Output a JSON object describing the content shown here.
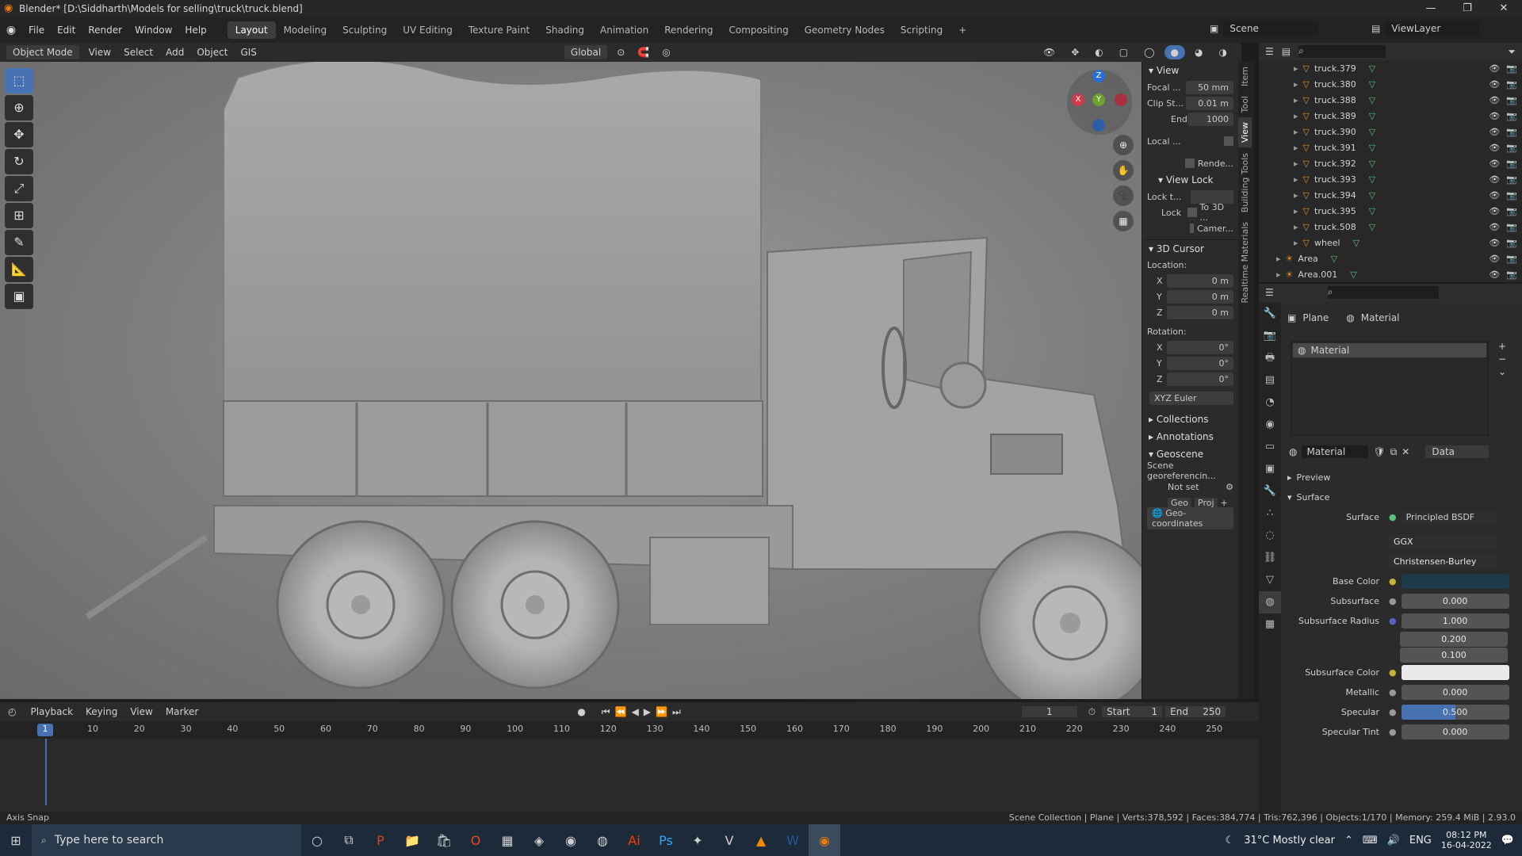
{
  "window": {
    "title": "Blender* [D:\\Siddharth\\Models for selling\\truck\\truck.blend]"
  },
  "menu": [
    "File",
    "Edit",
    "Render",
    "Window",
    "Help"
  ],
  "workspaces": [
    {
      "label": "Layout",
      "active": true
    },
    {
      "label": "Modeling"
    },
    {
      "label": "Sculpting"
    },
    {
      "label": "UV Editing"
    },
    {
      "label": "Texture Paint"
    },
    {
      "label": "Shading"
    },
    {
      "label": "Animation"
    },
    {
      "label": "Rendering"
    },
    {
      "label": "Compositing"
    },
    {
      "label": "Geometry Nodes"
    },
    {
      "label": "Scripting"
    }
  ],
  "scene": {
    "label": "Scene"
  },
  "viewlayer": {
    "label": "ViewLayer"
  },
  "viewport_header": {
    "mode": "Object Mode",
    "items": [
      "View",
      "Select",
      "Add",
      "Object",
      "GIS"
    ],
    "orientation": "Global"
  },
  "npanel": {
    "view_title": "View",
    "focal_label": "Focal ...",
    "focal_value": "50 mm",
    "clipstart_label": "Clip St...",
    "clipstart_value": "0.01 m",
    "end_label": "End",
    "end_value": "1000",
    "local_label": "Local ...",
    "rende_label": "Rende...",
    "viewlock_title": "View Lock",
    "lockt_label": "Lock t...",
    "lock_label": "Lock",
    "to3d_label": "To 3D ...",
    "camera_label": "Camer...",
    "cursor_title": "3D Cursor",
    "location_label": "Location:",
    "loc_x": "0 m",
    "loc_y": "0 m",
    "loc_z": "0 m",
    "rotation_label": "Rotation:",
    "rot_x": "0°",
    "rot_y": "0°",
    "rot_z": "0°",
    "euler": "XYZ Euler",
    "collections": "Collections",
    "annotations": "Annotations",
    "geoscene": "Geoscene",
    "scene_geo": "Scene georeferencin...",
    "not_set": "Not set",
    "geo": "Geo",
    "proj": "Proj",
    "geo_coords": "Geo-coordinates"
  },
  "sidetabs": [
    "Item",
    "Tool",
    "View",
    "Building Tools",
    "Realtime Materials"
  ],
  "outliner": {
    "rows": [
      {
        "name": "truck.379"
      },
      {
        "name": "truck.380"
      },
      {
        "name": "truck.388"
      },
      {
        "name": "truck.389"
      },
      {
        "name": "truck.390"
      },
      {
        "name": "truck.391"
      },
      {
        "name": "truck.392"
      },
      {
        "name": "truck.393"
      },
      {
        "name": "truck.394"
      },
      {
        "name": "truck.395"
      },
      {
        "name": "truck.508"
      },
      {
        "name": "wheel"
      },
      {
        "name": "Area"
      },
      {
        "name": "Area.001"
      }
    ]
  },
  "props": {
    "crumb_object": "Plane",
    "crumb_material": "Material",
    "slot": "Material",
    "mat_name": "Material",
    "data_label": "Data",
    "preview": "Preview",
    "surface_title": "Surface",
    "surface_label": "Surface",
    "surface_value": "Principled BSDF",
    "ggx": "GGX",
    "christensen": "Christensen-Burley",
    "base_color_label": "Base Color",
    "subsurface_label": "Subsurface",
    "subsurface_value": "0.000",
    "ssr_label": "Subsurface Radius",
    "ssr_1": "1.000",
    "ssr_2": "0.200",
    "ssr_3": "0.100",
    "ssc_label": "Subsurface Color",
    "metallic_label": "Metallic",
    "metallic_value": "0.000",
    "specular_label": "Specular",
    "specular_value": "0.500",
    "specular_fill": 0.5,
    "spectint_label": "Specular Tint",
    "spectint_value": "0.000"
  },
  "timeline": {
    "menus": [
      "Playback",
      "Keying",
      "View",
      "Marker"
    ],
    "current": "1",
    "start_label": "Start",
    "start": "1",
    "end_label": "End",
    "end": "250",
    "ticks": [
      "10",
      "20",
      "30",
      "40",
      "50",
      "60",
      "70",
      "80",
      "90",
      "100",
      "110",
      "120",
      "130",
      "140",
      "150",
      "160",
      "170",
      "180",
      "190",
      "200",
      "210",
      "220",
      "230",
      "240",
      "250"
    ],
    "frame_marker": "1"
  },
  "status": {
    "left": "Axis Snap",
    "right": "Scene Collection | Plane | Verts:378,592 | Faces:384,774 | Tris:762,396 | Objects:1/170 | Memory: 259.4 MiB | 2.93.0"
  },
  "taskbar": {
    "search_placeholder": "Type here to search",
    "weather": "31°C  Mostly clear",
    "lang": "ENG",
    "time": "08:12 PM",
    "date": "16-04-2022"
  },
  "colors": {
    "accent": "#4772b3",
    "orange_obj": "#e08a2e",
    "mesh_green": "#58c27a",
    "base_color": "#1d3a4a"
  }
}
